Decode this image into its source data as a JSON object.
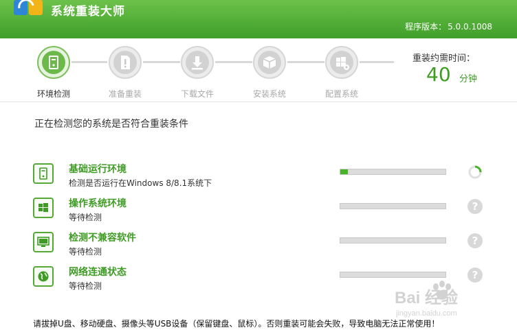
{
  "app": {
    "title": "系统重装大师",
    "version_label": "程序版本：",
    "version": "5.0.0.1008"
  },
  "steps": [
    {
      "label": "环境检测",
      "icon": "pc-tower-icon",
      "active": true
    },
    {
      "label": "准备重装",
      "icon": "document-alert-icon",
      "active": false
    },
    {
      "label": "下载文件",
      "icon": "download-icon",
      "active": false
    },
    {
      "label": "安装系统",
      "icon": "install-box-icon",
      "active": false
    },
    {
      "label": "配置系统",
      "icon": "windows-gear-icon",
      "active": false
    }
  ],
  "time": {
    "label": "重装约需时间：",
    "value": "40",
    "unit": "分钟"
  },
  "status_title": "正在检测您的系统是否符合重装条件",
  "checks": [
    {
      "title": "基础运行环境",
      "desc": "检测是否运行在Windows 8/8.1系统下",
      "progress": 0.07,
      "state": "loading",
      "icon": "pc-tower-icon"
    },
    {
      "title": "操作系统环境",
      "desc": "等待检测",
      "progress": 0,
      "state": "waiting",
      "icon": "windows-logo-icon"
    },
    {
      "title": "检测不兼容软件",
      "desc": "等待检测",
      "progress": 0,
      "state": "waiting",
      "icon": "monitor-icon"
    },
    {
      "title": "网络连通状态",
      "desc": "等待检测",
      "progress": 0,
      "state": "waiting",
      "icon": "globe-icon"
    }
  ],
  "state_symbol": "?",
  "footer": "请拔掉U盘、移动硬盘、摄像头等USB设备（保留键盘、鼠标）。否则重装可能会失败，导致电脑无法正常使用！",
  "watermark": {
    "text": "Bai 经验",
    "sub": "jingyan.baidu.com"
  },
  "colors": {
    "accent": "#3e9b23",
    "header": "#4fae34",
    "bar_fill": "#4ab429"
  }
}
